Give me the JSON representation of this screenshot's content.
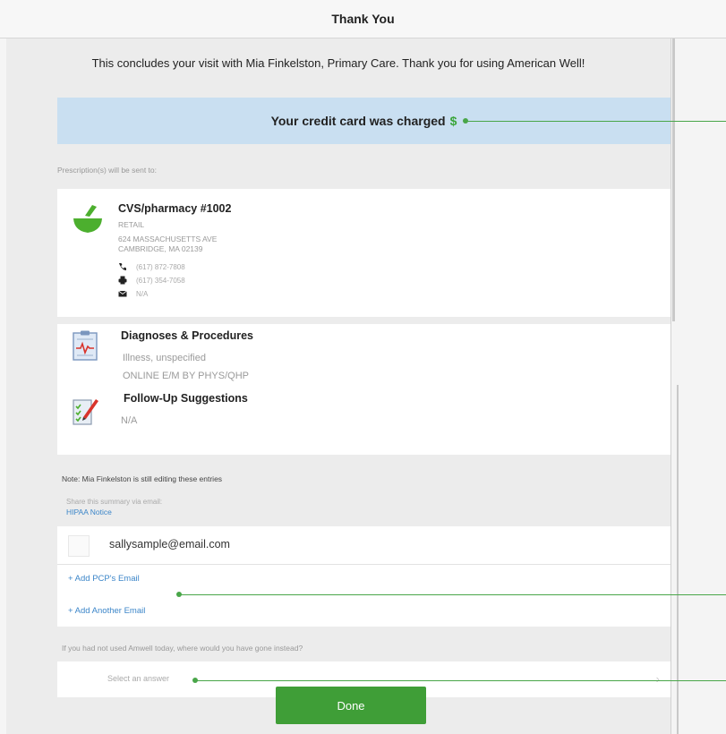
{
  "window": {
    "title": "Thank You"
  },
  "message": "This concludes your visit with Mia Finkelston, Primary Care.  Thank you for using American Well!",
  "charge": {
    "text": "Your credit card was charged",
    "amount": "$",
    "amount_color": "#3aa53a"
  },
  "prescriptions": {
    "label": "Prescription(s) will be sent to:",
    "pharmacy": {
      "name": "CVS/pharmacy #1002",
      "type": "RETAIL",
      "address_line1": "624 MASSACHUSETTS AVE",
      "address_line2": "CAMBRIDGE, MA 02139",
      "phone": "(617) 872-7808",
      "fax": "(617) 354-7058",
      "email": "N/A",
      "icon": "mortar-pestle-icon"
    }
  },
  "diagnoses": {
    "title": "Diagnoses & Procedures",
    "item1": "Illness, unspecified",
    "item2": "ONLINE E/M BY PHYS/QHP"
  },
  "follow_up": {
    "title": "Follow-Up Suggestions",
    "value": "N/A"
  },
  "note": "Note: Mia Finkelston is still editing these entries",
  "share": {
    "label": "Share this summary via email:",
    "hipaa_link": "HIPAA Notice",
    "email": "sallysample@email.com",
    "add_pcp": "+ Add PCP's Email",
    "add_another": "+ Add Another Email"
  },
  "survey": {
    "question": "If you had not used Amwell today, where would you have gone instead?",
    "placeholder": "Select an answer"
  },
  "done_label": "Done",
  "colors": {
    "accent_green": "#3f9e37",
    "banner_blue": "#c9dff1",
    "link_blue": "#3c86c9"
  }
}
